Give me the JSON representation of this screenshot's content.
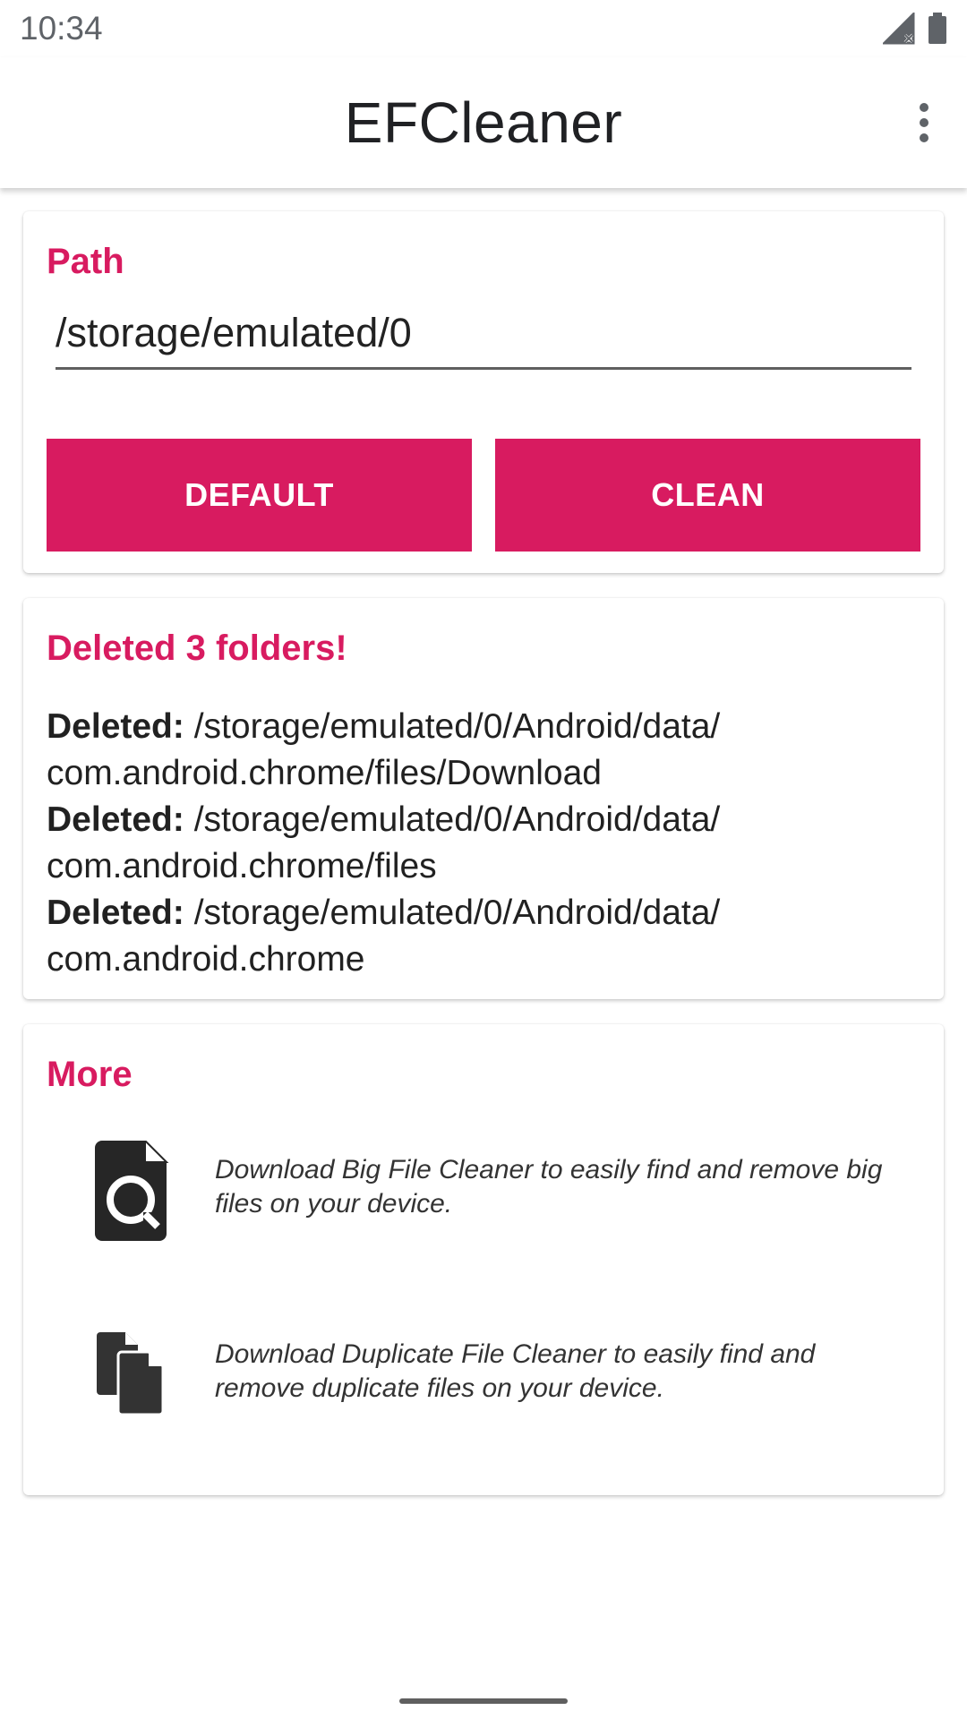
{
  "status_bar": {
    "time": "10:34"
  },
  "app_bar": {
    "title": "EFCleaner"
  },
  "path_card": {
    "title": "Path",
    "path_value": "/storage/emulated/0",
    "default_label": "DEFAULT",
    "clean_label": "CLEAN"
  },
  "results_card": {
    "title": "Deleted 3 folders!",
    "entries": [
      {
        "prefix": "Deleted:",
        "path_line1": "/storage/emulated/0/Android/data/",
        "path_line2": "com.android.chrome/files/Download"
      },
      {
        "prefix": "Deleted:",
        "path_line1": "/storage/emulated/0/Android/data/",
        "path_line2": "com.android.chrome/files"
      },
      {
        "prefix": "Deleted:",
        "path_line1": "/storage/emulated/0/Android/data/",
        "path_line2": "com.android.chrome"
      }
    ]
  },
  "more_card": {
    "title": "More",
    "items": [
      {
        "icon": "big-file-cleaner-icon",
        "text": "Download Big File Cleaner to easily find and remove big files on your device."
      },
      {
        "icon": "duplicate-file-cleaner-icon",
        "text": "Download Duplicate File Cleaner to easily find and remove duplicate files on your device."
      }
    ]
  },
  "colors": {
    "accent": "#d81b60"
  }
}
